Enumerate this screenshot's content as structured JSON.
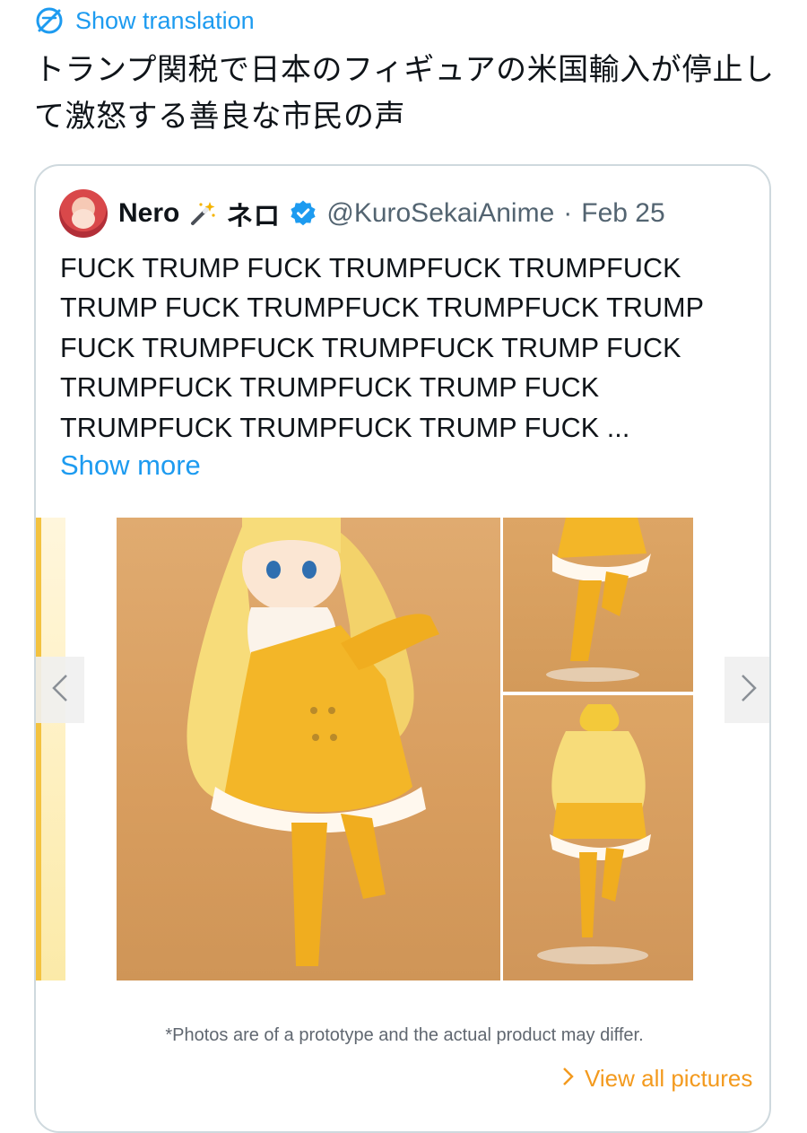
{
  "translate": {
    "label": "Show translation",
    "icon": "translate-icon"
  },
  "post": {
    "text": "トランプ関税で日本のフィギュアの米国輸入が停止して激怒する善良な市民の声"
  },
  "quote": {
    "display_name": "Nero",
    "display_name_jp": "ネロ",
    "handle": "@KuroSekaiAnime",
    "separator": "·",
    "date": "Feb 25",
    "body": "FUCK TRUMP FUCK TRUMPFUCK TRUMPFUCK\nTRUMP FUCK TRUMPFUCK TRUMPFUCK TRUMP\nFUCK TRUMPFUCK TRUMPFUCK TRUMP FUCK\nTRUMPFUCK TRUMPFUCK TRUMP FUCK\nTRUMPFUCK TRUMPFUCK TRUMP FUCK ...",
    "show_more": "Show more"
  },
  "media": {
    "disclaimer": "*Photos are of a prototype and the actual product may differ.",
    "view_all": "View all pictures",
    "prev_icon": "chevron-left-icon",
    "next_icon": "chevron-right-icon"
  },
  "colors": {
    "link_blue": "#1d9bf0",
    "muted_gray": "#536471",
    "border": "#cfd9de",
    "view_all_orange": "#f39a1e",
    "verified_blue": "#1d9bf0"
  }
}
